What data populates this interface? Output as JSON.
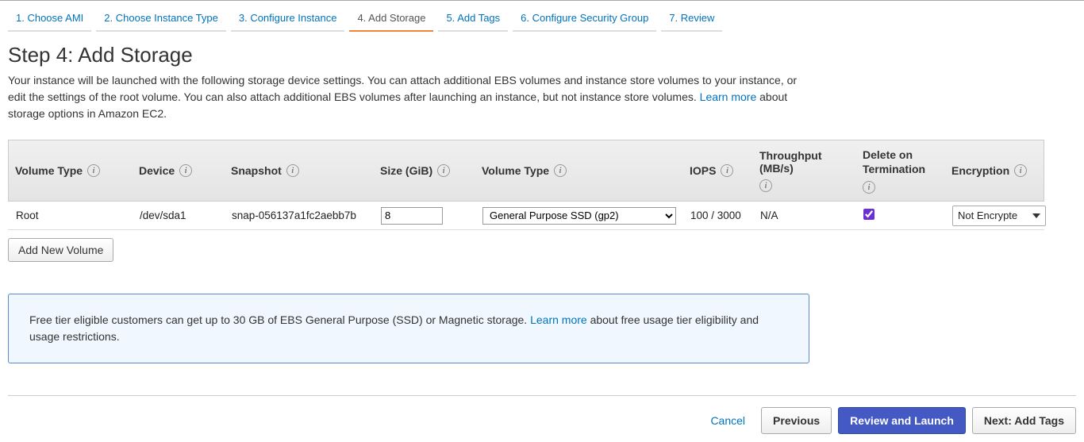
{
  "tabs": [
    {
      "label": "1. Choose AMI"
    },
    {
      "label": "2. Choose Instance Type"
    },
    {
      "label": "3. Configure Instance"
    },
    {
      "label": "4. Add Storage"
    },
    {
      "label": "5. Add Tags"
    },
    {
      "label": "6. Configure Security Group"
    },
    {
      "label": "7. Review"
    }
  ],
  "heading": "Step 4: Add Storage",
  "description_1": "Your instance will be launched with the following storage device settings. You can attach additional EBS volumes and instance store volumes to your instance, or edit the settings of the root volume. You can also attach additional EBS volumes after launching an instance, but not instance store volumes. ",
  "description_learn": "Learn more",
  "description_2": " about storage options in Amazon EC2.",
  "headers": {
    "voltype": "Volume Type",
    "device": "Device",
    "snapshot": "Snapshot",
    "size": "Size (GiB)",
    "voltype2": "Volume Type",
    "iops": "IOPS",
    "throughput": "Throughput (MB/s)",
    "delete": "Delete on Termination",
    "encryption": "Encryption"
  },
  "row": {
    "voltype": "Root",
    "device": "/dev/sda1",
    "snapshot": "snap-056137a1fc2aebb7b",
    "size": "8",
    "voltype2": "General Purpose SSD (gp2)",
    "iops": "100 / 3000",
    "throughput": "N/A",
    "delete_checked": true,
    "encryption": "Not Encrypte"
  },
  "add_volume": "Add New Volume",
  "infobox_1": "Free tier eligible customers can get up to 30 GB of EBS General Purpose (SSD) or Magnetic storage. ",
  "infobox_learn": "Learn more",
  "infobox_2": " about free usage tier eligibility and usage restrictions.",
  "footer": {
    "cancel": "Cancel",
    "previous": "Previous",
    "review": "Review and Launch",
    "next": "Next: Add Tags"
  }
}
